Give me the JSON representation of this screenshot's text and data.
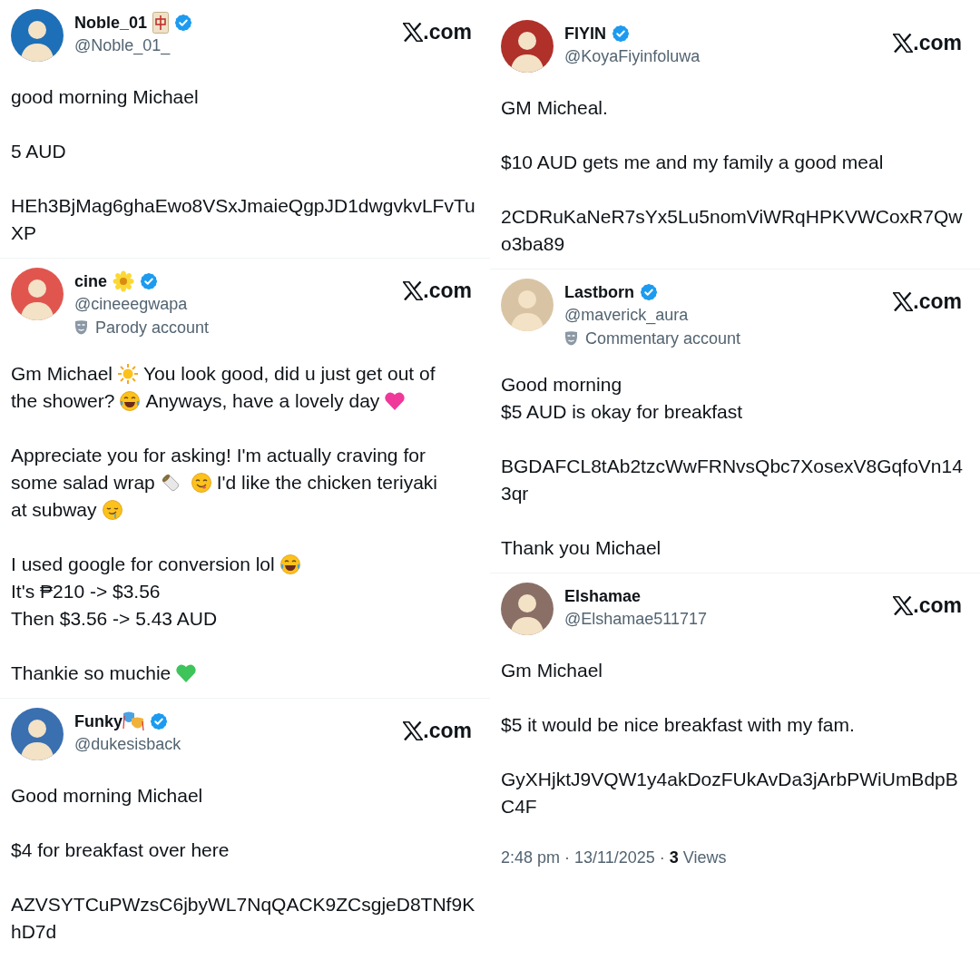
{
  "columns": [
    {
      "tweets": [
        {
          "author": {
            "name": "Noble_01",
            "name_icon": {
              "kind": "tile"
            },
            "verified": true,
            "handle": "@Noble_01_"
          },
          "site": ".com",
          "paragraphs": [
            [
              "good morning Michael"
            ],
            [
              "5 AUD"
            ],
            [
              "HEh3BjMag6ghaEwo8VSxJmaieQgpJD1dwgvkvLFvTuXP"
            ]
          ]
        },
        {
          "author": {
            "name": "cine",
            "name_icon": {
              "kind": "flower"
            },
            "verified": true,
            "handle": "@cineeegwapa",
            "label": "Parody account"
          },
          "site": ".com",
          "paragraphs": [
            [
              [
                {
                  "text": "Gm Michael"
                },
                {
                  "kind": "sun"
                },
                {
                  "text": "You look good, did u just get out of"
                }
              ],
              [
                {
                  "text": "the shower?"
                },
                {
                  "kind": "joy"
                },
                {
                  "text": "Anyways, have a lovely day"
                },
                {
                  "kind": "pink_heart"
                }
              ]
            ],
            [
              "Appreciate you for asking! I'm actually craving for",
              [
                {
                  "text": "some salad wrap"
                },
                {
                  "kind": "wrap"
                },
                {
                  "kind": "yum"
                },
                {
                  "text": "I'd like the chicken teriyaki"
                }
              ],
              [
                {
                  "text": "at subway"
                },
                {
                  "kind": "drool"
                }
              ]
            ],
            [
              [
                {
                  "text": "I used google for conversion lol"
                },
                {
                  "kind": "joy"
                }
              ],
              "It's ₱210 -> $3.56",
              "Then $3.56 -> 5.43 AUD"
            ],
            [
              [
                {
                  "text": "Thankie so muchie"
                },
                {
                  "kind": "green_heart"
                }
              ]
            ]
          ]
        },
        {
          "author": {
            "name": "Funky",
            "name_icon": {
              "kind": "masks"
            },
            "verified": true,
            "handle": "@dukesisback"
          },
          "site": ".com",
          "paragraphs": [
            [
              "Good morning Michael"
            ],
            [
              "$4 for breakfast over here"
            ],
            [
              "AZVSYTCuPWzsC6jbyWL7NqQACK9ZCsgjeD8TNf9KhD7d"
            ]
          ]
        }
      ]
    },
    {
      "tweets": [
        {
          "author": {
            "name": "FIYIN",
            "verified": true,
            "handle": "@KoyaFiyinfoluwa"
          },
          "site": ".com",
          "paragraphs": [
            [
              "GM Micheal."
            ],
            [
              "$10 AUD gets me and my family a good meal"
            ],
            [
              "2CDRuKaNeR7sYx5Lu5nomViWRqHPKVWCoxR7Qwo3ba89"
            ]
          ]
        },
        {
          "author": {
            "name": "Lastborn",
            "verified": true,
            "handle": "@maverick_aura",
            "label": "Commentary account"
          },
          "site": ".com",
          "paragraphs": [
            [
              "Good morning",
              "$5 AUD is okay for breakfast"
            ],
            [
              "BGDAFCL8tAb2tzcWwFRNvsQbc7XosexV8GqfoVn143qr"
            ],
            [
              "Thank you Michael"
            ]
          ]
        },
        {
          "author": {
            "name": "Elshamae",
            "verified": false,
            "handle": "@Elshamae511717"
          },
          "site": ".com",
          "paragraphs": [
            [
              "Gm Michael"
            ],
            [
              "$5 it would be nice breakfast with my fam."
            ],
            [
              "GyXHjktJ9VQW1y4akDozFUkAvDa3jArbPWiUmBdpBC4F"
            ]
          ],
          "footer": "2:48 pm · 13/11/2025 · **3** Views"
        }
      ]
    }
  ]
}
